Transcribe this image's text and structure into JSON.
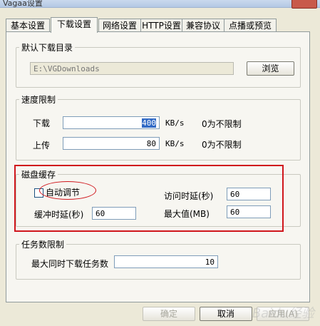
{
  "window": {
    "title": "Vagaa设置"
  },
  "tabs": [
    "基本设置",
    "下载设置",
    "网络设置",
    "HTTP设置",
    "兼容协议",
    "点播或预览"
  ],
  "default_dir": {
    "legend": "默认下载目录",
    "path": "E:\\VGDownloads",
    "browse_label": "浏览"
  },
  "speed": {
    "legend": "速度限制",
    "download_label": "下载",
    "download_value": "400",
    "upload_label": "上传",
    "upload_value": "80",
    "unit": "KB/s",
    "hint": "0为不限制"
  },
  "cache": {
    "legend": "磁盘缓存",
    "auto_label": "自动调节",
    "auto_checked": false,
    "access_delay_label": "访问时延(秒)",
    "access_delay_value": "60",
    "buffer_delay_label": "缓冲时延(秒)",
    "buffer_delay_value": "60",
    "max_label": "最大值(MB)",
    "max_value": "60"
  },
  "tasks": {
    "legend": "任务数限制",
    "max_tasks_label": "最大同时下载任务数",
    "max_tasks_value": "10"
  },
  "footer": {
    "ok_label": "确定",
    "cancel_label": "取消",
    "apply_label": "应用(A)"
  },
  "watermark": "Baidu经验",
  "colors": {
    "annotation": "#d0161c",
    "selection": "#316ac5"
  }
}
